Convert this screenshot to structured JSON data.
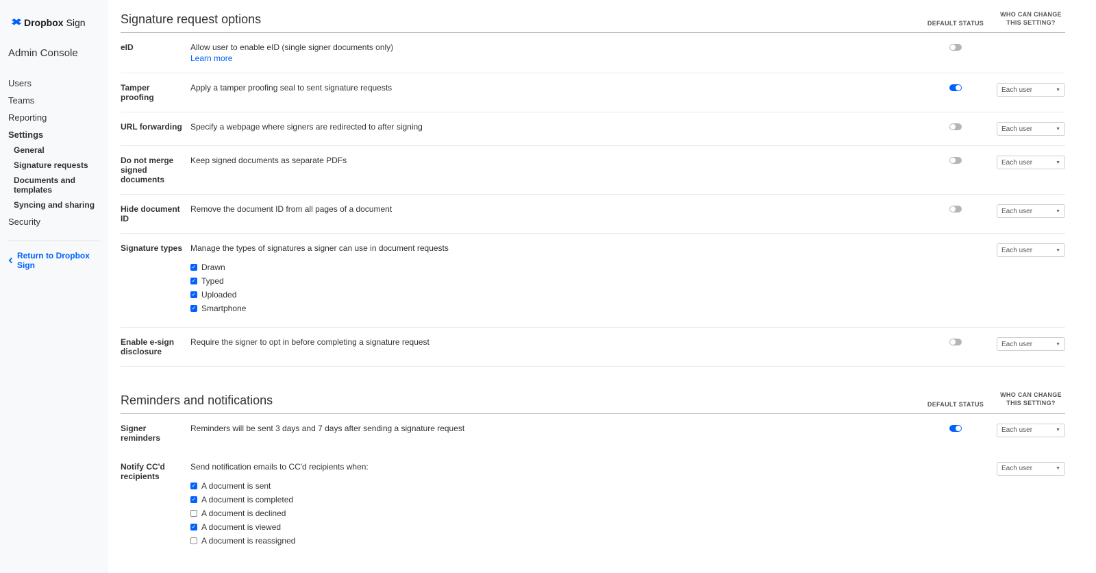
{
  "sidebar": {
    "brand_main": "Dropbox",
    "brand_sub": "Sign",
    "console_title": "Admin Console",
    "nav": {
      "users": "Users",
      "teams": "Teams",
      "reporting": "Reporting",
      "settings": "Settings",
      "settings_sub": {
        "general": "General",
        "sig_requests": "Signature requests",
        "docs_templates": "Documents and templates",
        "syncing": "Syncing and sharing"
      },
      "security": "Security"
    },
    "return_link": "Return to Dropbox Sign"
  },
  "section1": {
    "title": "Signature request options",
    "col_status": "DEFAULT STATUS",
    "col_who": "WHO CAN CHANGE THIS SETTING?"
  },
  "dropdown_label": "Each user",
  "rows": {
    "eid": {
      "label": "eID",
      "desc": "Allow user to enable eID (single signer documents only)",
      "learn": "Learn more"
    },
    "tamper": {
      "label": "Tamper proofing",
      "desc": "Apply a tamper proofing seal to sent signature requests"
    },
    "url": {
      "label": "URL forwarding",
      "desc": "Specify a webpage where signers are redirected to after signing"
    },
    "merge": {
      "label": "Do not merge signed documents",
      "desc": "Keep signed documents as separate PDFs"
    },
    "hide": {
      "label": "Hide document ID",
      "desc": "Remove the document ID from all pages of a document"
    },
    "sigtypes": {
      "label": "Signature types",
      "desc": "Manage the types of signatures a signer can use in document requests",
      "opts": {
        "drawn": "Drawn",
        "typed": "Typed",
        "uploaded": "Uploaded",
        "smartphone": "Smartphone"
      }
    },
    "esign": {
      "label": "Enable e-sign disclosure",
      "desc": "Require the signer to opt in before completing a signature request"
    }
  },
  "section2": {
    "title": "Reminders and notifications",
    "col_status": "DEFAULT STATUS",
    "col_who": "WHO CAN CHANGE THIS SETTING?"
  },
  "rows2": {
    "reminders": {
      "label": "Signer reminders",
      "desc": "Reminders will be sent 3 days and 7 days after sending a signature request"
    },
    "notify": {
      "label": "Notify CC'd recipients",
      "desc": "Send notification emails to CC'd recipients when:",
      "opts": {
        "sent": "A document is sent",
        "completed": "A document is completed",
        "declined": "A document is declined",
        "viewed": "A document is viewed",
        "reassigned": "A document is reassigned"
      }
    }
  }
}
